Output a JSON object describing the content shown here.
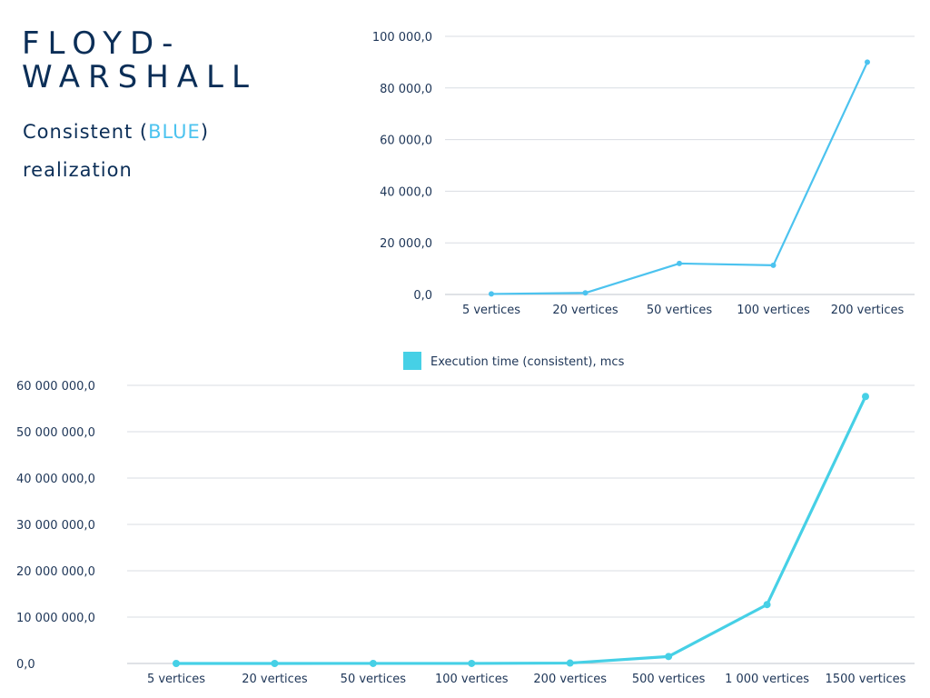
{
  "header": {
    "title_line1": "FLOYD-",
    "title_line2": "WARSHALL",
    "subtitle_before": "Consistent (",
    "subtitle_highlight": "BLUE",
    "subtitle_after": ")",
    "subtitle_line2": "realization"
  },
  "colors": {
    "title": "#0b2e57",
    "highlight": "#4cc3ef",
    "top_series": "#4cc3ef",
    "bottom_series": "#46d0e6",
    "gridline": "#d9dde3",
    "axis": "#bfc5cc"
  },
  "chart_data": [
    {
      "type": "line",
      "categories": [
        "5 vertices",
        "20 vertices",
        "50 vertices",
        "100 vertices",
        "200 vertices"
      ],
      "series": [
        {
          "values": [
            200,
            600,
            12000,
            11300,
            90000
          ]
        }
      ],
      "ylim": [
        0,
        100000
      ],
      "yticks": [
        0,
        20000,
        40000,
        60000,
        80000,
        100000
      ],
      "ytick_labels": [
        "0,0",
        "20 000,0",
        "40 000,0",
        "60 000,0",
        "80 000,0",
        "100 000,0"
      ],
      "grid": true,
      "legend": "none"
    },
    {
      "type": "line",
      "categories": [
        "5 vertices",
        "20 vertices",
        "50 vertices",
        "100 vertices",
        "200 vertices",
        "500 vertices",
        "1 000 vertices",
        "1500 vertices"
      ],
      "series": [
        {
          "name": "Execution time (consistent), mcs",
          "values": [
            200,
            600,
            12000,
            11300,
            90000,
            1500000,
            12700000,
            57600000
          ]
        }
      ],
      "ylim": [
        0,
        60000000
      ],
      "yticks": [
        0,
        10000000,
        20000000,
        30000000,
        40000000,
        50000000,
        60000000
      ],
      "ytick_labels": [
        "0,0",
        "10 000 000,0",
        "20 000 000,0",
        "30 000 000,0",
        "40 000 000,0",
        "50 000 000,0",
        "60 000 000,0"
      ],
      "grid": true,
      "legend": "top-center"
    }
  ]
}
